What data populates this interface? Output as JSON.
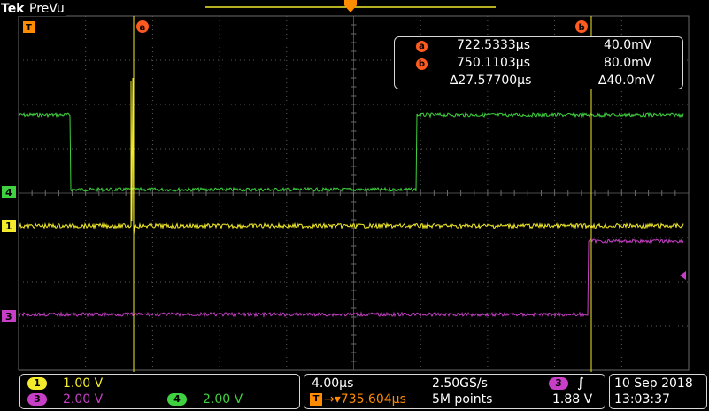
{
  "header": {
    "brand": "Tek",
    "mode": "PreVu"
  },
  "cursor_readout": {
    "a_label": "a",
    "b_label": "b",
    "a_time": "722.5333µs",
    "a_value": "40.0mV",
    "b_time": "750.1103µs",
    "b_value": "80.0mV",
    "delta_time": "∆27.57700µs",
    "delta_value": "∆40.0mV"
  },
  "markers": {
    "trigger": "T",
    "cursor_a": "a",
    "cursor_b": "b",
    "ch4": "4",
    "ch1": "1",
    "ch3": "3"
  },
  "channels": [
    {
      "id": "1",
      "scale": "1.00 V",
      "color": "#f2ea2a"
    },
    {
      "id": "3",
      "scale": "2.00 V",
      "color": "#c63fc6"
    },
    {
      "id": "4",
      "scale": "2.00 V",
      "color": "#3fd13f"
    }
  ],
  "timebase": {
    "scale": "4.00µs",
    "sample_rate": "2.50GS/s",
    "trigger_position": "▾735.604µs",
    "trigger_badge": "T",
    "record_length": "5M points"
  },
  "trigger": {
    "source": "3",
    "slope_symbol": "∫",
    "level": "1.88 V"
  },
  "datetime": {
    "date": "10 Sep  2018",
    "time": "13:03:37"
  },
  "colors": {
    "ch1": "#f2ea2a",
    "ch3": "#c63fc6",
    "ch4": "#3fd13f",
    "accent": "#ff8c00",
    "cursor_badge": "#ff5a1f"
  }
}
